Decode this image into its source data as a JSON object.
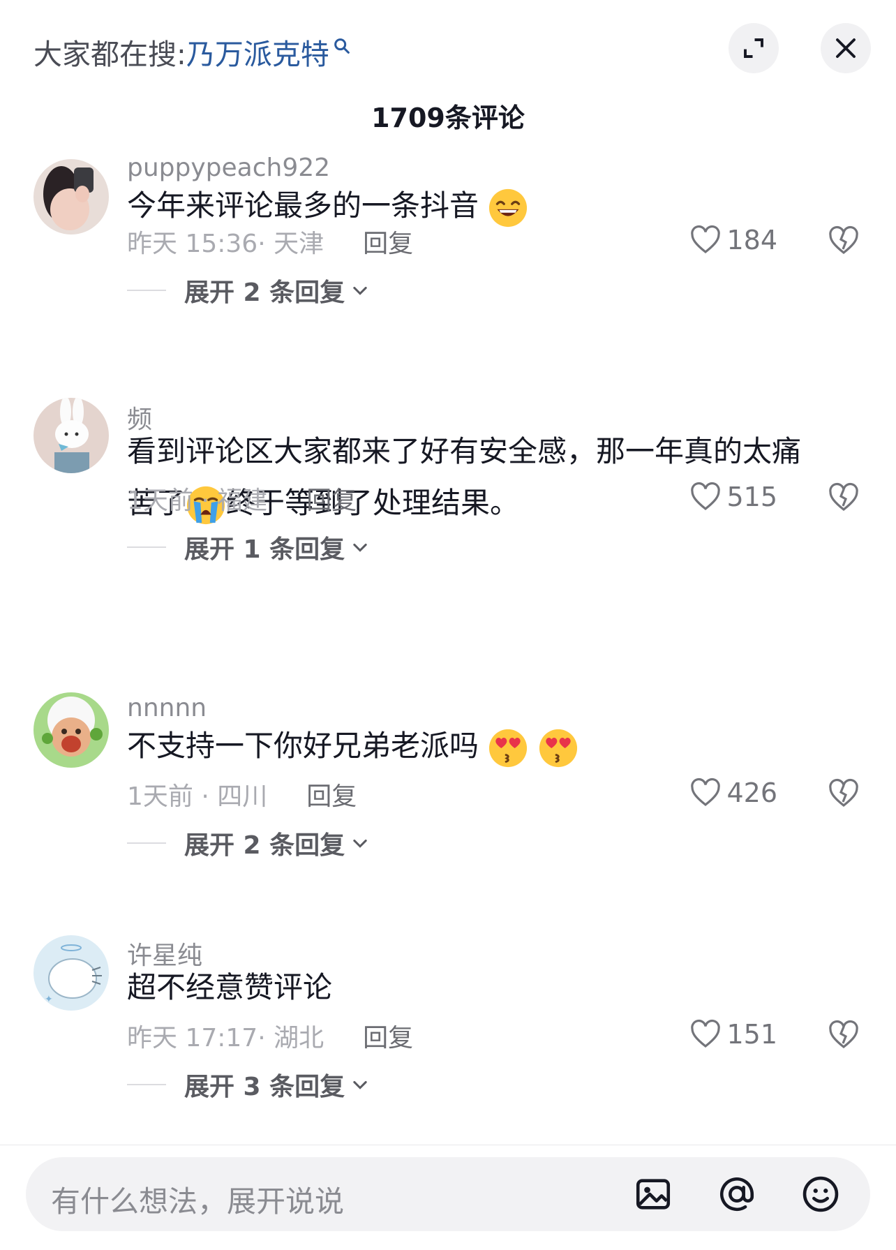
{
  "header": {
    "hot_search_prefix": "大家都在搜:",
    "hot_search_keyword": "乃万派克特"
  },
  "comment_count": "1709条评论",
  "comments": [
    {
      "username": "puppypeach922",
      "text": "今年来评论最多的一条抖音",
      "text2": "",
      "time": "昨天 15:36· 天津",
      "reply_label": "回复",
      "likes": "184",
      "expand": "展开 2 条回复"
    },
    {
      "username": "频",
      "text": "看到评论区大家都来了好有安全感，那一年真的太痛",
      "text2_a": "苦了",
      "text2_b": "终于等到了处理结果。",
      "time": "1天前 · 福建",
      "reply_label": "回复",
      "likes": "515",
      "expand": "展开 1 条回复"
    },
    {
      "username": "nnnnn",
      "text": "不支持一下你好兄弟老派吗",
      "time": "1天前 · 四川",
      "reply_label": "回复",
      "likes": "426",
      "expand": "展开 2 条回复"
    },
    {
      "username": "许星纯",
      "text": "超不经意赞评论",
      "time": "昨天 17:17· 湖北",
      "reply_label": "回复",
      "likes": "151",
      "expand": "展开 3 条回复"
    }
  ],
  "input": {
    "placeholder": "有什么想法，展开说说"
  }
}
